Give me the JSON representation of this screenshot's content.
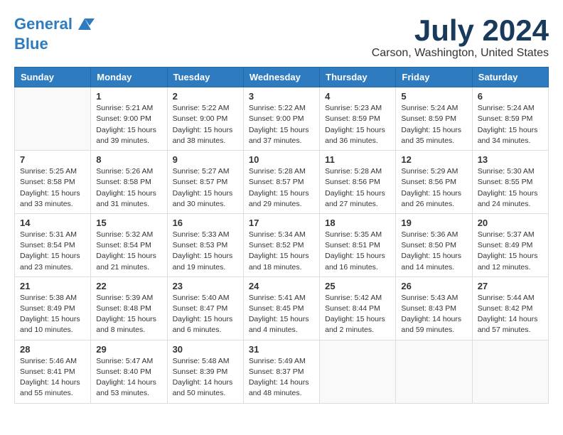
{
  "logo": {
    "line1": "General",
    "line2": "Blue"
  },
  "title": "July 2024",
  "subtitle": "Carson, Washington, United States",
  "weekdays": [
    "Sunday",
    "Monday",
    "Tuesday",
    "Wednesday",
    "Thursday",
    "Friday",
    "Saturday"
  ],
  "weeks": [
    [
      {
        "day": "",
        "info": ""
      },
      {
        "day": "1",
        "info": "Sunrise: 5:21 AM\nSunset: 9:00 PM\nDaylight: 15 hours\nand 39 minutes."
      },
      {
        "day": "2",
        "info": "Sunrise: 5:22 AM\nSunset: 9:00 PM\nDaylight: 15 hours\nand 38 minutes."
      },
      {
        "day": "3",
        "info": "Sunrise: 5:22 AM\nSunset: 9:00 PM\nDaylight: 15 hours\nand 37 minutes."
      },
      {
        "day": "4",
        "info": "Sunrise: 5:23 AM\nSunset: 8:59 PM\nDaylight: 15 hours\nand 36 minutes."
      },
      {
        "day": "5",
        "info": "Sunrise: 5:24 AM\nSunset: 8:59 PM\nDaylight: 15 hours\nand 35 minutes."
      },
      {
        "day": "6",
        "info": "Sunrise: 5:24 AM\nSunset: 8:59 PM\nDaylight: 15 hours\nand 34 minutes."
      }
    ],
    [
      {
        "day": "7",
        "info": "Sunrise: 5:25 AM\nSunset: 8:58 PM\nDaylight: 15 hours\nand 33 minutes."
      },
      {
        "day": "8",
        "info": "Sunrise: 5:26 AM\nSunset: 8:58 PM\nDaylight: 15 hours\nand 31 minutes."
      },
      {
        "day": "9",
        "info": "Sunrise: 5:27 AM\nSunset: 8:57 PM\nDaylight: 15 hours\nand 30 minutes."
      },
      {
        "day": "10",
        "info": "Sunrise: 5:28 AM\nSunset: 8:57 PM\nDaylight: 15 hours\nand 29 minutes."
      },
      {
        "day": "11",
        "info": "Sunrise: 5:28 AM\nSunset: 8:56 PM\nDaylight: 15 hours\nand 27 minutes."
      },
      {
        "day": "12",
        "info": "Sunrise: 5:29 AM\nSunset: 8:56 PM\nDaylight: 15 hours\nand 26 minutes."
      },
      {
        "day": "13",
        "info": "Sunrise: 5:30 AM\nSunset: 8:55 PM\nDaylight: 15 hours\nand 24 minutes."
      }
    ],
    [
      {
        "day": "14",
        "info": "Sunrise: 5:31 AM\nSunset: 8:54 PM\nDaylight: 15 hours\nand 23 minutes."
      },
      {
        "day": "15",
        "info": "Sunrise: 5:32 AM\nSunset: 8:54 PM\nDaylight: 15 hours\nand 21 minutes."
      },
      {
        "day": "16",
        "info": "Sunrise: 5:33 AM\nSunset: 8:53 PM\nDaylight: 15 hours\nand 19 minutes."
      },
      {
        "day": "17",
        "info": "Sunrise: 5:34 AM\nSunset: 8:52 PM\nDaylight: 15 hours\nand 18 minutes."
      },
      {
        "day": "18",
        "info": "Sunrise: 5:35 AM\nSunset: 8:51 PM\nDaylight: 15 hours\nand 16 minutes."
      },
      {
        "day": "19",
        "info": "Sunrise: 5:36 AM\nSunset: 8:50 PM\nDaylight: 15 hours\nand 14 minutes."
      },
      {
        "day": "20",
        "info": "Sunrise: 5:37 AM\nSunset: 8:49 PM\nDaylight: 15 hours\nand 12 minutes."
      }
    ],
    [
      {
        "day": "21",
        "info": "Sunrise: 5:38 AM\nSunset: 8:49 PM\nDaylight: 15 hours\nand 10 minutes."
      },
      {
        "day": "22",
        "info": "Sunrise: 5:39 AM\nSunset: 8:48 PM\nDaylight: 15 hours\nand 8 minutes."
      },
      {
        "day": "23",
        "info": "Sunrise: 5:40 AM\nSunset: 8:47 PM\nDaylight: 15 hours\nand 6 minutes."
      },
      {
        "day": "24",
        "info": "Sunrise: 5:41 AM\nSunset: 8:45 PM\nDaylight: 15 hours\nand 4 minutes."
      },
      {
        "day": "25",
        "info": "Sunrise: 5:42 AM\nSunset: 8:44 PM\nDaylight: 15 hours\nand 2 minutes."
      },
      {
        "day": "26",
        "info": "Sunrise: 5:43 AM\nSunset: 8:43 PM\nDaylight: 14 hours\nand 59 minutes."
      },
      {
        "day": "27",
        "info": "Sunrise: 5:44 AM\nSunset: 8:42 PM\nDaylight: 14 hours\nand 57 minutes."
      }
    ],
    [
      {
        "day": "28",
        "info": "Sunrise: 5:46 AM\nSunset: 8:41 PM\nDaylight: 14 hours\nand 55 minutes."
      },
      {
        "day": "29",
        "info": "Sunrise: 5:47 AM\nSunset: 8:40 PM\nDaylight: 14 hours\nand 53 minutes."
      },
      {
        "day": "30",
        "info": "Sunrise: 5:48 AM\nSunset: 8:39 PM\nDaylight: 14 hours\nand 50 minutes."
      },
      {
        "day": "31",
        "info": "Sunrise: 5:49 AM\nSunset: 8:37 PM\nDaylight: 14 hours\nand 48 minutes."
      },
      {
        "day": "",
        "info": ""
      },
      {
        "day": "",
        "info": ""
      },
      {
        "day": "",
        "info": ""
      }
    ]
  ]
}
